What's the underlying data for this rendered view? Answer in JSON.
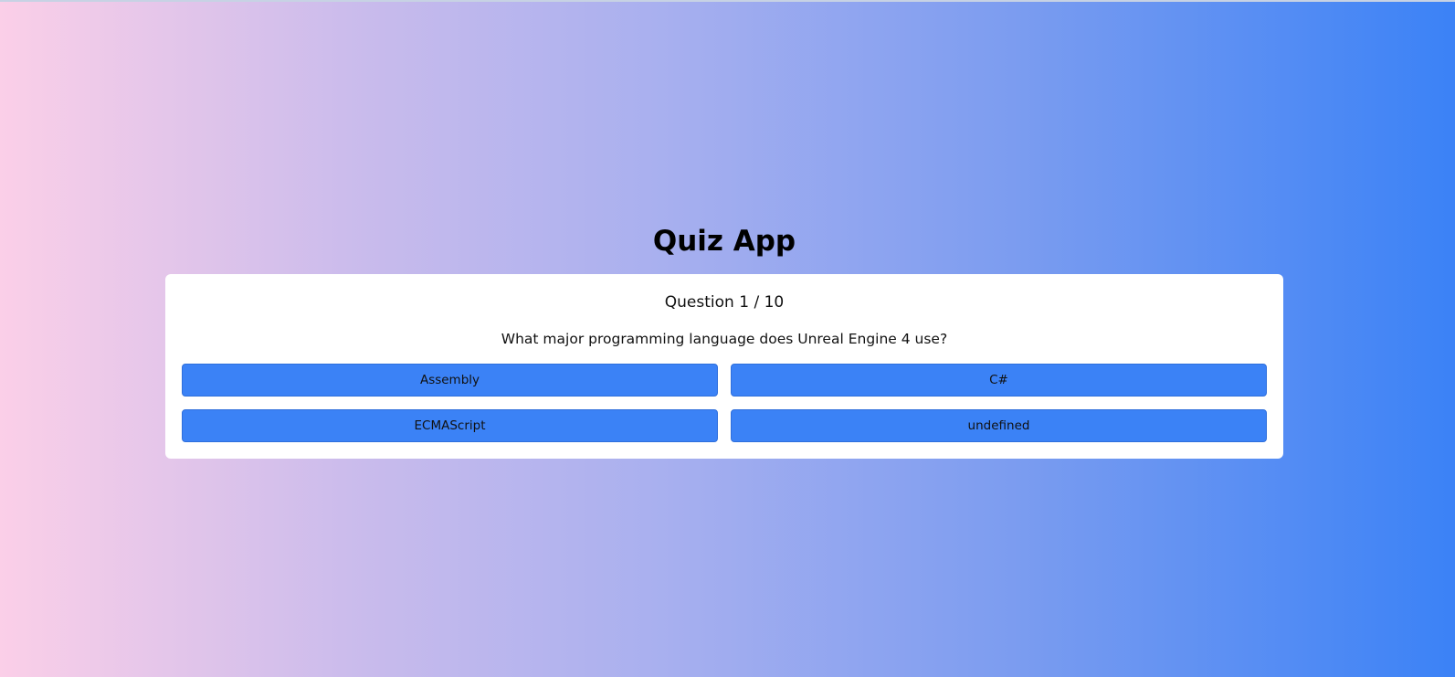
{
  "app": {
    "title": "Quiz App"
  },
  "quiz": {
    "progress_label": "Question 1 / 10",
    "current_question": 1,
    "total_questions": 10,
    "question": "What major programming language does Unreal Engine 4 use?",
    "answers": [
      {
        "label": "Assembly"
      },
      {
        "label": "C#"
      },
      {
        "label": "ECMAScript"
      },
      {
        "label": "undefined"
      }
    ]
  },
  "colors": {
    "gradient_start": "#fbcfe8",
    "gradient_end": "#3b82f6",
    "answer_button": "#3b82f6",
    "card_background": "#ffffff"
  }
}
